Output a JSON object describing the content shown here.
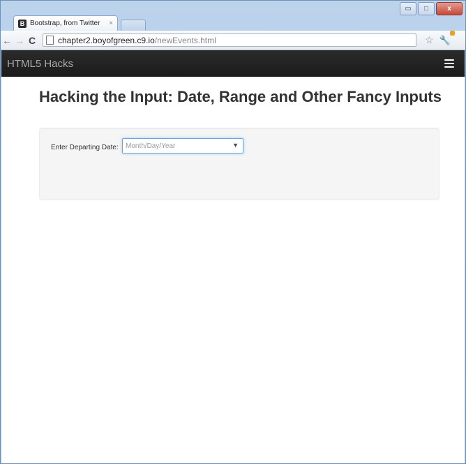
{
  "browser": {
    "tab_title": "Bootstrap, from Twitter",
    "tab_favicon": "B",
    "tab_close": "×",
    "url_host": "chapter2.boyofgreen.c9.io",
    "url_path": "/newEvents.html",
    "window_controls": {
      "minimize": "▭",
      "maximize": "□",
      "close": "x"
    }
  },
  "navbar": {
    "brand": "HTML5 Hacks",
    "menu_icon": "hamburger-icon"
  },
  "main": {
    "title": "Hacking the Input: Date, Range and Other Fancy Inputs",
    "form": {
      "label": "Enter Departing Date:",
      "date_placeholder": "Month/Day/Year",
      "dropdown_arrow": "▼"
    }
  },
  "colors": {
    "navbar_bg": "#222222",
    "brand_text": "#a9a9a9",
    "input_focus": "#6ea3d6"
  }
}
